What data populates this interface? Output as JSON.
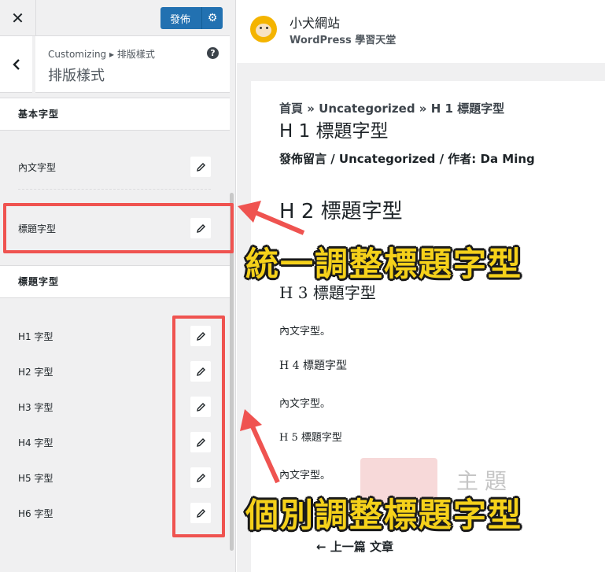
{
  "topbar": {
    "close_label": "✕",
    "publish_label": "發佈",
    "settings_glyph": "⚙"
  },
  "header": {
    "breadcrumb": "Customizing ▸ 排版樣式",
    "title": "排版樣式",
    "help_glyph": "?"
  },
  "groups": [
    {
      "heading": "基本字型",
      "rows": [
        {
          "label": "內文字型"
        },
        {
          "label": "標題字型"
        }
      ]
    },
    {
      "heading": "標題字型",
      "rows": [
        {
          "label": "H1 字型"
        },
        {
          "label": "H2 字型"
        },
        {
          "label": "H3 字型"
        },
        {
          "label": "H4 字型"
        },
        {
          "label": "H5 字型"
        },
        {
          "label": "H6 字型"
        }
      ]
    }
  ],
  "preview": {
    "site_title": "小犬網站",
    "site_tagline": "WordPress 學習天堂",
    "breadcrumb": "首頁 » Uncategorized » H 1 標題字型",
    "h1": "H 1 標題字型",
    "meta": "發佈留言 / Uncategorized / 作者: Da Ming",
    "h2": "H 2 標題字型",
    "h3": "H 3 標題字型",
    "para1": "內文字型。",
    "h4": "H 4 標題字型",
    "para2": "內文字型。",
    "h5": "H 5 標題字型",
    "para3": "內文字型。",
    "prev_post": "← 上一篇 文章"
  },
  "watermark": {
    "text": "主題"
  },
  "annotations": {
    "callout_unified": "統一調整標題字型",
    "callout_individual": "個別調整標題字型",
    "highlight_color": "#ef5350",
    "callout_color": "#f5d11a"
  },
  "colors": {
    "accent": "#2271b1",
    "panel_bg": "#f0f0f1"
  }
}
